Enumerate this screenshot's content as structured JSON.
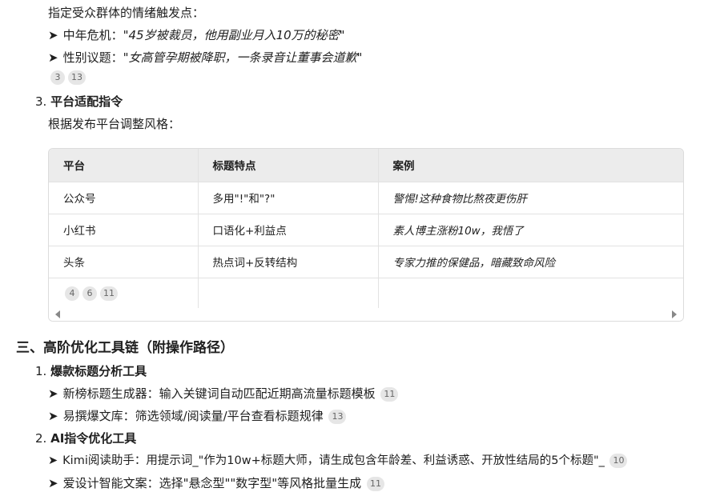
{
  "intro": "指定受众群体的情绪触发点：",
  "emotion_items": [
    {
      "label": "中年危机：",
      "quote": "\"45岁被裁员，他用副业月入10万的秘密\""
    },
    {
      "label": "性别议题：",
      "quote": "\"女高管孕期被降职，一条录音让董事会道歉\""
    }
  ],
  "emotion_badges": [
    "3",
    "13"
  ],
  "section3": {
    "number": "3.",
    "title": "平台适配指令",
    "desc": "根据发布平台调整风格："
  },
  "table": {
    "headers": [
      "平台",
      "标题特点",
      "案例"
    ],
    "rows": [
      [
        "公众号",
        "多用\"!\"和\"?\"",
        "警惕!这种食物比熬夜更伤肝"
      ],
      [
        "小红书",
        "口语化+利益点",
        "素人博主涨粉10w，我悟了"
      ],
      [
        "头条",
        "热点词+反转结构",
        "专家力推的保健品，暗藏致命风险"
      ]
    ],
    "badges": [
      "4",
      "6",
      "11"
    ]
  },
  "section_h2": "三、高阶优化工具链（附操作路径）",
  "tools": [
    {
      "number": "1.",
      "title": "爆款标题分析工具",
      "items": [
        {
          "text": "新榜标题生成器：输入关键词自动匹配近期高流量标题模板",
          "badge": "11"
        },
        {
          "text": "易撰爆文库：筛选领域/阅读量/平台查看标题规律",
          "badge": "13"
        }
      ]
    },
    {
      "number": "2.",
      "title": "AI指令优化工具",
      "items": [
        {
          "text": "Kimi阅读助手：用提示词_\"作为10w+标题大师，请生成包含年龄差、利益诱惑、开放性结局的5个标题\"_",
          "badge": "10"
        },
        {
          "text": "爱设计智能文案：选择\"悬念型\"\"数字型\"等风格批量生成",
          "badge": "11"
        }
      ]
    }
  ]
}
